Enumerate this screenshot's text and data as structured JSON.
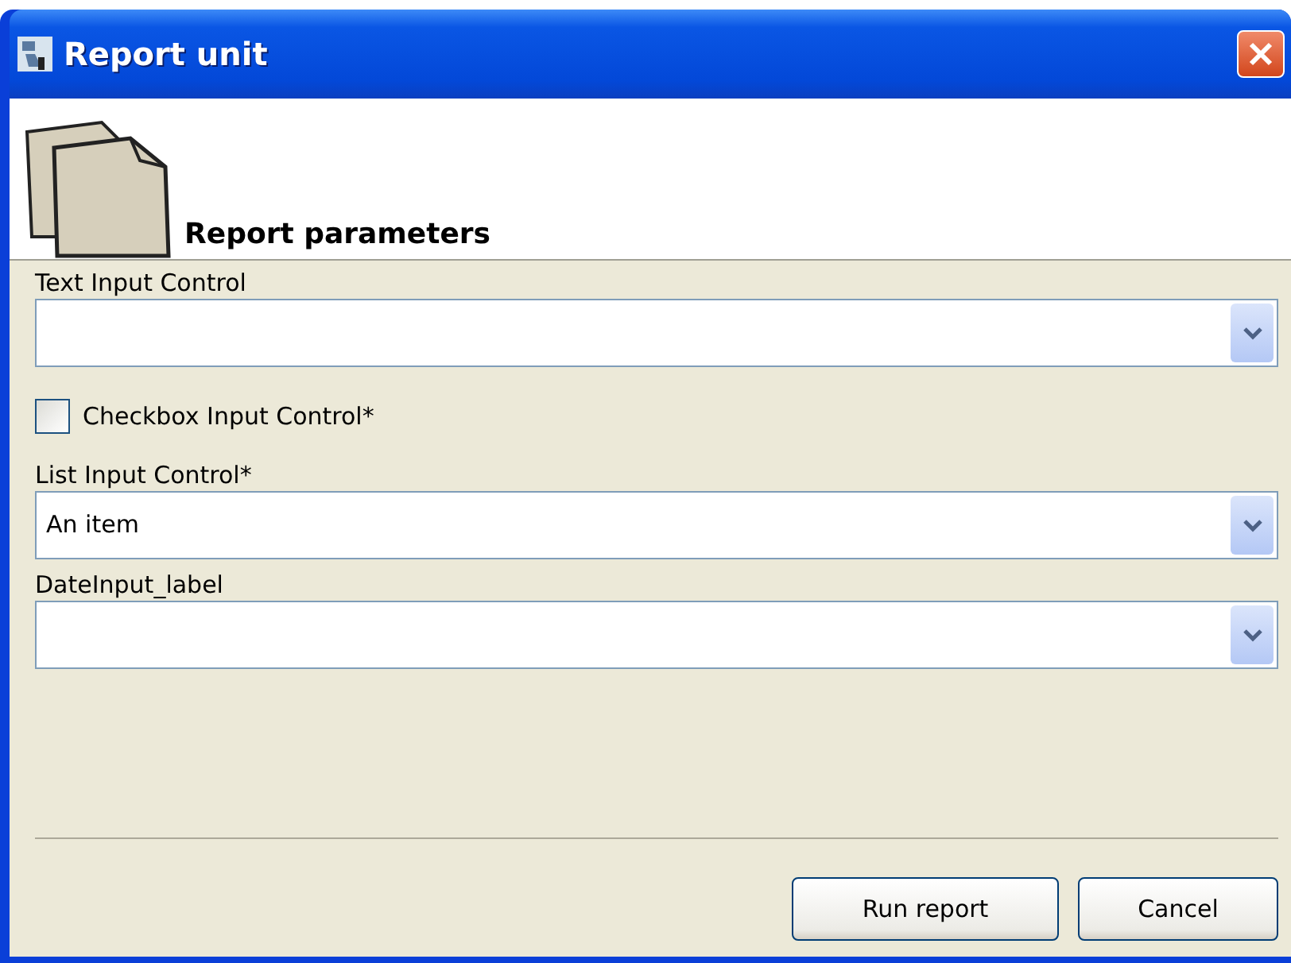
{
  "window": {
    "title": "Report unit"
  },
  "header": {
    "title": "Report parameters"
  },
  "controls": [
    {
      "kind": "combo",
      "label": "Text Input Control"
    },
    {
      "kind": "checkbox",
      "label": "Checkbox Input Control*",
      "checked": false
    },
    {
      "kind": "combo",
      "label": "List Input Control*",
      "value": "An item"
    },
    {
      "kind": "combo",
      "label": "DateInput_label"
    }
  ],
  "buttons": [
    "Run report",
    "Cancel"
  ]
}
